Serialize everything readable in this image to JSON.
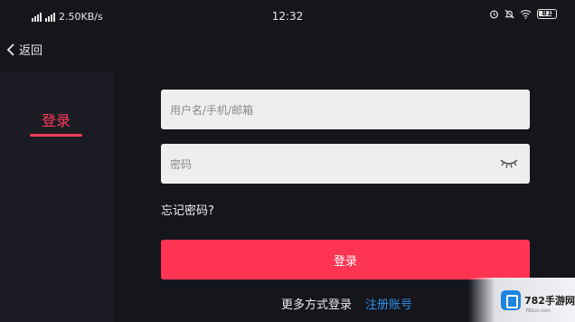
{
  "status_bar": {
    "network_speed": "2.50KB/s",
    "time": "12:32",
    "battery": "81"
  },
  "topbar": {
    "back_label": "返回"
  },
  "sidebar": {
    "tab_label": "登录"
  },
  "form": {
    "username_placeholder": "用户名/手机/邮箱",
    "password_placeholder": "密码",
    "forgot_label": "忘记密码?",
    "login_button": "登录"
  },
  "footer": {
    "more_methods": "更多方式登录",
    "register": "注册账号"
  },
  "watermark": {
    "brand": "782手游网",
    "url": "782cn.com"
  },
  "colors": {
    "background": "#15161c",
    "panel": "#1b1c23",
    "accent": "#fe3452",
    "link": "#2f8fe8",
    "input_bg": "#eeeeef"
  }
}
